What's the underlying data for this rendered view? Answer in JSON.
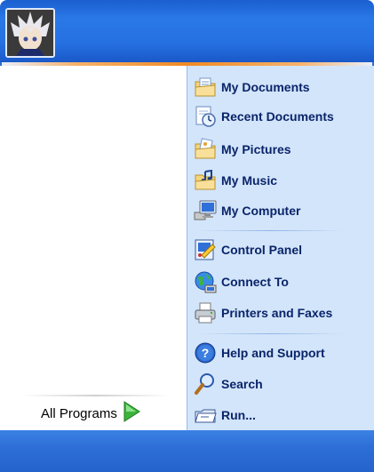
{
  "header": {
    "avatar_icon": "user-avatar-icon"
  },
  "left": {
    "all_programs_label": "All Programs",
    "arrow_icon": "green-arrow-icon"
  },
  "right": {
    "items": [
      {
        "label": "My Documents",
        "icon": "folder-documents-icon"
      },
      {
        "label": "Recent Documents",
        "icon": "recent-documents-icon"
      },
      {
        "label": "My Pictures",
        "icon": "folder-pictures-icon"
      },
      {
        "label": "My Music",
        "icon": "folder-music-icon"
      },
      {
        "label": "My Computer",
        "icon": "computer-icon"
      },
      {
        "label": "Control Panel",
        "icon": "control-panel-icon"
      },
      {
        "label": "Connect To",
        "icon": "globe-network-icon"
      },
      {
        "label": "Printers and Faxes",
        "icon": "printer-icon"
      },
      {
        "label": "Help and Support",
        "icon": "help-icon"
      },
      {
        "label": "Search",
        "icon": "search-icon"
      },
      {
        "label": "Run...",
        "icon": "run-icon"
      }
    ]
  },
  "colors": {
    "header_blue": "#2670e2",
    "right_pane": "#d3e5fa",
    "label_navy": "#0a246a",
    "accent_orange": "#f08a24"
  }
}
